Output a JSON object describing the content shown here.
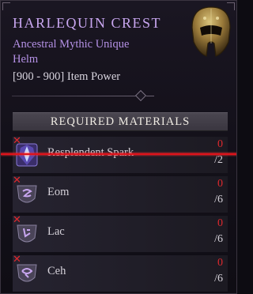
{
  "item": {
    "name": "HARLEQUIN CREST",
    "rarity_line": "Ancestral Mythic Unique",
    "slot": "Helm",
    "power": "[900 - 900] Item Power",
    "icon": "helm-icon"
  },
  "materials": {
    "header": "REQUIRED MATERIALS",
    "items": [
      {
        "name": "Resplendent Spark",
        "have": "0",
        "need": "/2",
        "icon": "spark-icon",
        "missing_mark": "✕"
      },
      {
        "name": "Eom",
        "have": "0",
        "need": "/6",
        "icon": "rune-icon",
        "missing_mark": "✕"
      },
      {
        "name": "Lac",
        "have": "0",
        "need": "/6",
        "icon": "rune-icon",
        "missing_mark": "✕"
      },
      {
        "name": "Ceh",
        "have": "0",
        "need": "/6",
        "icon": "rune-icon",
        "missing_mark": "✕"
      }
    ]
  },
  "colors": {
    "title": "#c8a6ef",
    "missing": "#e0282e",
    "strike": "#e0121a"
  }
}
